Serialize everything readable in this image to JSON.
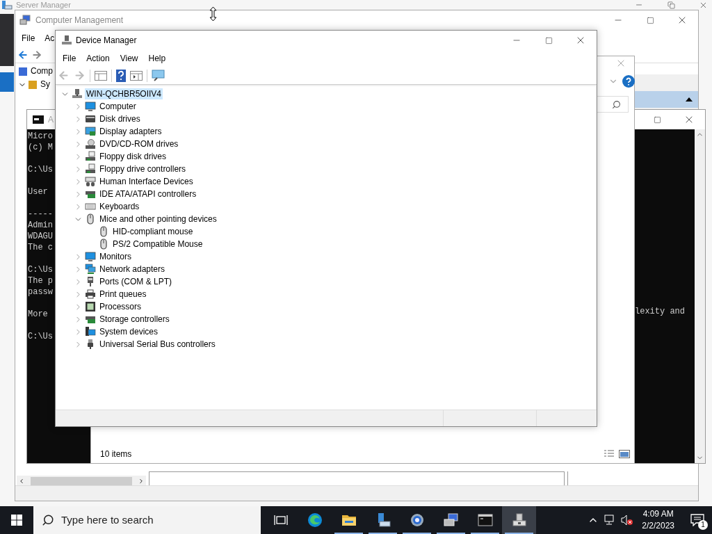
{
  "server_manager": {
    "title": "Server Manager"
  },
  "computer_management": {
    "title": "Computer Management",
    "menu": [
      "File",
      "Ac"
    ],
    "tree": [
      {
        "label": "Comp"
      },
      {
        "label": "Sy",
        "expanded": true
      }
    ]
  },
  "console": {
    "title": "A",
    "paragraphs": [
      [
        "Micro",
        "(c) M"
      ],
      [
        "C:\\Us"
      ],
      [
        "User"
      ],
      [
        "-----",
        "Admin",
        "WDAGU",
        "The c"
      ],
      [
        "C:\\Us",
        "The p",
        "passw"
      ],
      [
        "More"
      ],
      [
        "C:\\Us"
      ]
    ],
    "right_text": "lexity and"
  },
  "back_window": {
    "status": "10 items"
  },
  "device_manager": {
    "title": "Device Manager",
    "menu": [
      "File",
      "Action",
      "View",
      "Help"
    ],
    "tree": {
      "label": "WIN-QCHBR5OIIV4",
      "kind": "host",
      "expanded": true,
      "selected": true,
      "children": [
        {
          "label": "Computer",
          "kind": "computer",
          "expanded": false
        },
        {
          "label": "Disk drives",
          "kind": "disk",
          "expanded": false
        },
        {
          "label": "Display adapters",
          "kind": "display",
          "expanded": false
        },
        {
          "label": "DVD/CD-ROM drives",
          "kind": "dvd",
          "expanded": false
        },
        {
          "label": "Floppy disk drives",
          "kind": "floppy",
          "expanded": false
        },
        {
          "label": "Floppy drive controllers",
          "kind": "floppy",
          "expanded": false
        },
        {
          "label": "Human Interface Devices",
          "kind": "hid",
          "expanded": false
        },
        {
          "label": "IDE ATA/ATAPI controllers",
          "kind": "card",
          "expanded": false
        },
        {
          "label": "Keyboards",
          "kind": "keyboard",
          "expanded": false
        },
        {
          "label": "Mice and other pointing devices",
          "kind": "mouse",
          "expanded": true,
          "children": [
            {
              "label": "HID-compliant mouse",
              "kind": "mouse"
            },
            {
              "label": "PS/2 Compatible Mouse",
              "kind": "mouse"
            }
          ]
        },
        {
          "label": "Monitors",
          "kind": "computer",
          "expanded": false
        },
        {
          "label": "Network adapters",
          "kind": "network",
          "expanded": false
        },
        {
          "label": "Ports (COM & LPT)",
          "kind": "port",
          "expanded": false
        },
        {
          "label": "Print queues",
          "kind": "printer",
          "expanded": false
        },
        {
          "label": "Processors",
          "kind": "processor",
          "expanded": false
        },
        {
          "label": "Storage controllers",
          "kind": "card",
          "expanded": false
        },
        {
          "label": "System devices",
          "kind": "system",
          "expanded": false
        },
        {
          "label": "Universal Serial Bus controllers",
          "kind": "usb",
          "expanded": false
        }
      ]
    }
  },
  "taskbar": {
    "search": {
      "placeholder": "Type here to search"
    },
    "apps": [
      {
        "kind": "taskview",
        "running": false,
        "selected": false
      },
      {
        "kind": "browser",
        "running": false,
        "selected": false
      },
      {
        "kind": "folder",
        "running": true,
        "selected": false
      },
      {
        "kind": "server",
        "running": true,
        "selected": false
      },
      {
        "kind": "gear",
        "running": true,
        "selected": false
      },
      {
        "kind": "computer",
        "running": true,
        "selected": false
      },
      {
        "kind": "terminal",
        "running": true,
        "selected": false
      },
      {
        "kind": "devices",
        "running": true,
        "selected": true
      }
    ],
    "time": "4:09 AM",
    "date": "2/2/2023",
    "notifications": "1"
  }
}
